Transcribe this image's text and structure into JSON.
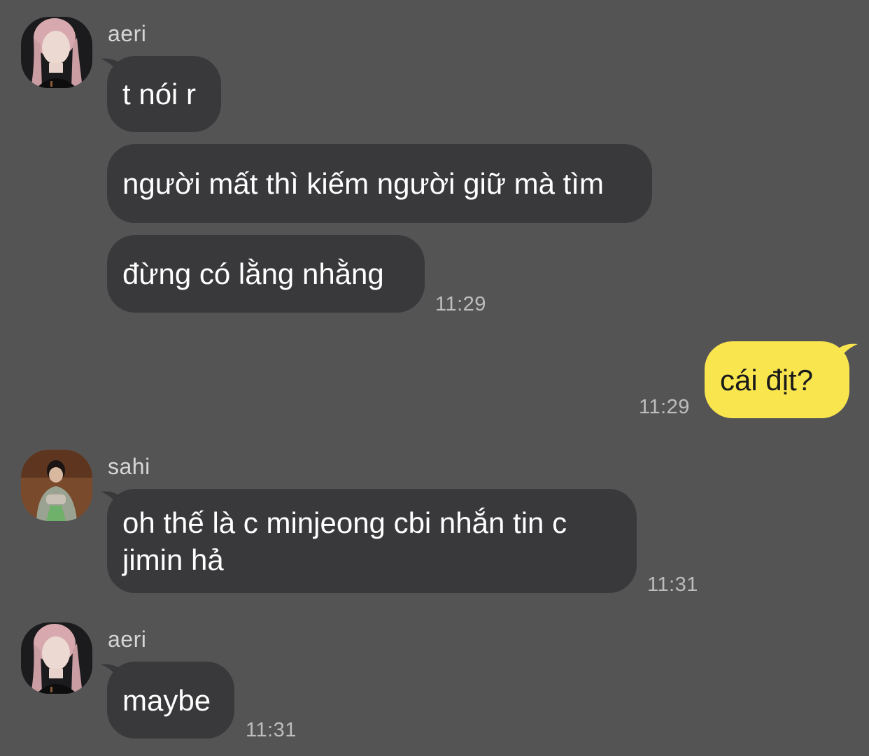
{
  "messages": [
    {
      "sender": "aeri",
      "lines": [
        "t nói r",
        "người mất thì kiếm người giữ mà tìm",
        "đừng có lằng nhằng"
      ],
      "time": "11:29"
    },
    {
      "sender": "me",
      "lines": [
        "cái địt?"
      ],
      "time": "11:29"
    },
    {
      "sender": "sahi",
      "lines": [
        "oh thế là c minjeong cbi nhắn tin c jimin hả"
      ],
      "time": "11:31"
    },
    {
      "sender": "aeri",
      "lines": [
        "maybe"
      ],
      "time": "11:31"
    }
  ],
  "colors": {
    "background": "#555455",
    "incoming_bubble": "#39383a",
    "outgoing_bubble": "#f9e54e"
  }
}
